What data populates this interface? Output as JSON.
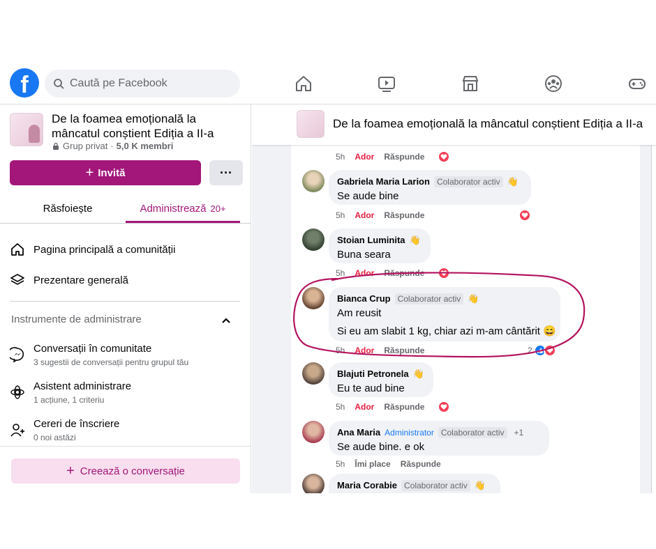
{
  "topbar": {
    "logo": "f",
    "search_placeholder": "Caută pe Facebook",
    "nav_icons": [
      "home-icon",
      "watch-icon",
      "marketplace-icon",
      "groups-icon",
      "gaming-icon"
    ]
  },
  "group": {
    "title": "De la foamea emoțională la mâncatul conștient Ediția a II-a",
    "privacy": "Grup privat",
    "sep": "·",
    "members": "5,0 K membri",
    "invite_label": "Invită",
    "more_label": "···"
  },
  "tabs": {
    "browse": "Răsfoiește",
    "admin": "Administrează",
    "admin_count": "20+"
  },
  "menu": {
    "home": "Pagina principală a comunității",
    "overview": "Prezentare generală"
  },
  "admin_tools": {
    "heading": "Instrumente de administrare",
    "items": [
      {
        "title": "Conversații în comunitate",
        "subtitle": "3 sugestii de conversații pentru grupul tău"
      },
      {
        "title": "Asistent administrare",
        "subtitle": "1 acțiune, 1 criteriu"
      },
      {
        "title": "Cereri de înscriere",
        "subtitle": "0 noi astăzi"
      }
    ],
    "create_label": "Creează o conversație"
  },
  "feed": {
    "header_title": "De la foamea emoțională la mâncatul conștient Ediția a II-a",
    "comments": [
      {
        "name": "",
        "badge": "",
        "text": "",
        "time": "5h",
        "action1": "Ador",
        "reply": "Răspunde"
      },
      {
        "name": "Gabriela Maria Larion",
        "badge": "Colaborator activ",
        "text": "Se aude bine",
        "time": "5h",
        "action1": "Ador",
        "reply": "Răspunde"
      },
      {
        "name": "Stoian Luminita",
        "badge": "",
        "text": "Buna seara",
        "time": "5h",
        "action1": "Ador",
        "reply": "Răspunde"
      },
      {
        "name": "Bianca Crup",
        "badge": "Colaborator activ",
        "text": "Am reusit",
        "text2": "Si eu am slabit 1 kg, chiar azi m-am cântărit 😄",
        "time": "5h",
        "action1": "Ador",
        "reply": "Răspunde",
        "reactions": "2"
      },
      {
        "name": "Blajuti Petronela",
        "badge": "",
        "text": "Eu te aud bine",
        "time": "5h",
        "action1": "Ador",
        "reply": "Răspunde"
      },
      {
        "name": "Ana Maria",
        "badge_admin": "Administrator",
        "badge": "Colaborator activ",
        "badge_more": "+1",
        "text": "Se aude bine. e ok",
        "time": "5h",
        "action1": "Îmi place",
        "reply": "Răspunde"
      },
      {
        "name": "Maria Corabie",
        "badge": "Colaborator activ",
        "text": "",
        "time": "",
        "action1": "",
        "reply": ""
      }
    ]
  },
  "colors": {
    "brand": "#1877f2",
    "accent": "#a3167a",
    "annotation": "#b5135f",
    "love": "#e41e3f"
  }
}
